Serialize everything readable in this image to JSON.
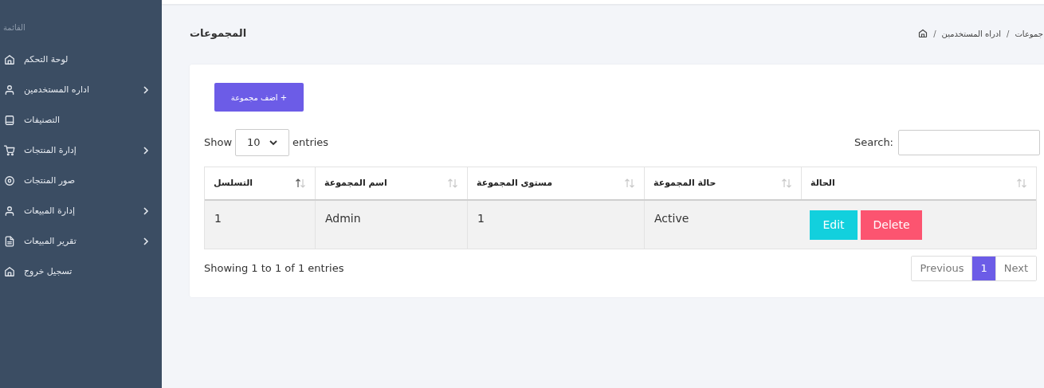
{
  "sidebar": {
    "heading": "القائمة",
    "items": [
      {
        "label": "لوحة التحكم",
        "kind": "home",
        "expandable": false
      },
      {
        "label": "اداره المستخدمين",
        "kind": "user",
        "expandable": true
      },
      {
        "label": "التصنيفات",
        "kind": "book",
        "expandable": false
      },
      {
        "label": "إدارة المنتجات",
        "kind": "cart",
        "expandable": true
      },
      {
        "label": "صور المنتجات",
        "kind": "target",
        "expandable": false
      },
      {
        "label": "إدارة المبيعات",
        "kind": "user",
        "expandable": true
      },
      {
        "label": "تقرير المبيعات",
        "kind": "file",
        "expandable": true
      },
      {
        "label": "تسجيل خروج",
        "kind": "home",
        "expandable": false
      }
    ]
  },
  "page": {
    "title": "المجموعات",
    "breadcrumb": [
      {
        "kind": "link",
        "text": "جموعات"
      },
      {
        "kind": "separator",
        "text": "/"
      },
      {
        "kind": "link",
        "text": "ادراه المستخدمين"
      },
      {
        "kind": "separator",
        "text": "/"
      }
    ]
  },
  "card": {
    "add_button": "اضف مجموعة +",
    "length": {
      "before": "Show",
      "value": "10",
      "after": "entries"
    },
    "search_label": "Search:",
    "table": {
      "columns": [
        {
          "label": "الحالة",
          "sorted": false
        },
        {
          "label": "حالة المجموعة",
          "sorted": false
        },
        {
          "label": "مستوى المجموعة",
          "sorted": false
        },
        {
          "label": "اسم المجموعة",
          "sorted": false
        },
        {
          "label": "التسلسل",
          "sorted": true
        }
      ],
      "rows": [
        {
          "cells": [
            {
              "kind": "actions",
              "buttons": [
                {
                  "kind": "delete",
                  "label": "Delete"
                },
                {
                  "kind": "edit",
                  "label": "Edit"
                }
              ]
            },
            {
              "kind": "text",
              "text": "Active"
            },
            {
              "kind": "text",
              "text": "1"
            },
            {
              "kind": "text",
              "text": "Admin"
            },
            {
              "kind": "text",
              "text": "1"
            }
          ]
        }
      ]
    },
    "info": "Showing 1 to 1 of 1 entries",
    "pagination": [
      {
        "label": "Next",
        "selected": false
      },
      {
        "label": "1",
        "selected": true
      },
      {
        "label": "Previous",
        "selected": false
      }
    ]
  }
}
